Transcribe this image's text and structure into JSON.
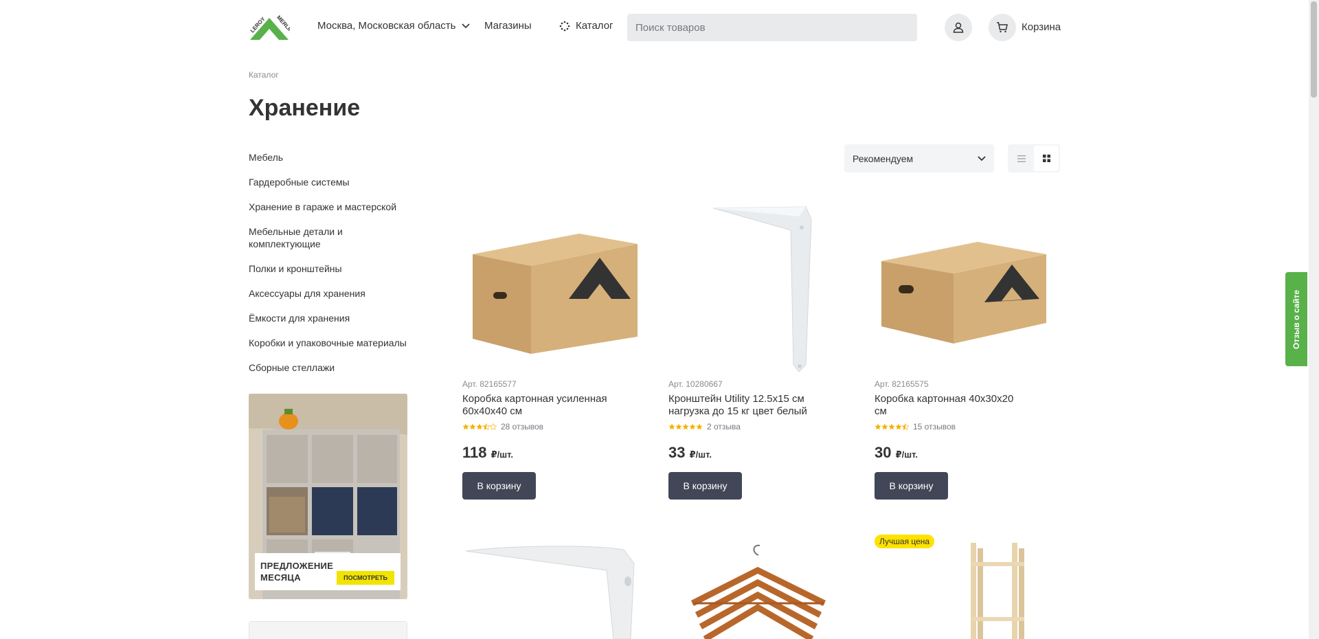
{
  "header": {
    "region": "Москва, Московская область",
    "stores": "Магазины",
    "catalog": "Каталог",
    "search_placeholder": "Поиск товаров",
    "cart": "Корзина"
  },
  "breadcrumb": "Каталог",
  "page_title": "Хранение",
  "sidebar": {
    "items": [
      {
        "label": "Мебель"
      },
      {
        "label": "Гардеробные системы"
      },
      {
        "label": "Хранение в гараже и мастерской"
      },
      {
        "label": "Мебельные детали и комплектующие"
      },
      {
        "label": "Полки и кронштейны"
      },
      {
        "label": "Аксессуары для хранения"
      },
      {
        "label": "Ёмкости для хранения"
      },
      {
        "label": "Коробки и упаковочные материалы"
      },
      {
        "label": "Сборные стеллажи"
      }
    ],
    "promo": {
      "title_line1": "ПРЕДЛОЖЕНИЕ",
      "title_line2": "МЕСЯЦА",
      "link": "ПОСМОТРЕТЬ"
    }
  },
  "toolbar": {
    "sort_value": "Рекомендуем"
  },
  "products": [
    {
      "art": "Арт. 82165577",
      "name": "Коробка картонная усиленная 60х40х40 см",
      "reviews": "28 отзывов",
      "rating": 3.5,
      "price": "118",
      "unit": "₽/шт.",
      "buy": "В корзину"
    },
    {
      "art": "Арт. 10280667",
      "name": "Кронштейн Utility 12.5х15 см нагрузка до 15 кг цвет белый",
      "reviews": "2 отзыва",
      "rating": 5,
      "price": "33",
      "unit": "₽/шт.",
      "buy": "В корзину"
    },
    {
      "art": "Арт. 82165575",
      "name": "Коробка картонная 40х30х20 см",
      "reviews": "15 отзывов",
      "rating": 4.5,
      "price": "30",
      "unit": "₽/шт.",
      "buy": "В корзину"
    }
  ],
  "badge_best_price": "Лучшая цена",
  "feedback": "Отзыв о сайте",
  "colors": {
    "accent_green": "#59b14a",
    "button_dark": "#414756",
    "star": "#f5b100",
    "badge_yellow": "#ffe200"
  }
}
